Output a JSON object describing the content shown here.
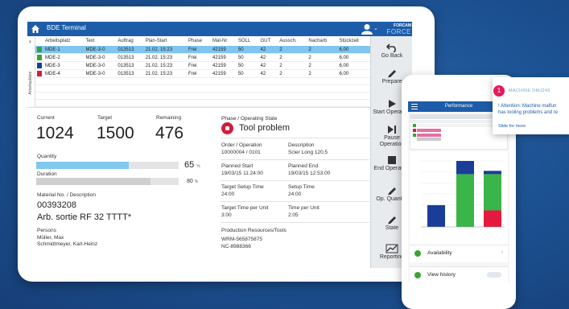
{
  "app": {
    "title": "BDE Terminal",
    "brand_top": "FORCAM",
    "brand_bottom": "FORCE"
  },
  "grid": {
    "columns": [
      "Arbeitsplatz",
      "Text",
      "Auftrag",
      "Plan-Start",
      "Phase",
      "Mat-Nr",
      "SOLL",
      "GUT",
      "Aussch.",
      "Nacharb",
      "Stückzeit"
    ],
    "side_label": "Arbeitsplätze",
    "rows": [
      {
        "status_color": "#3aa335",
        "cells": [
          "MDE-1",
          "MDE-3-0",
          "013513",
          "21.02. 15:23",
          "Frei",
          "42159",
          "50",
          "42",
          "2",
          "2",
          "6,00"
        ]
      },
      {
        "status_color": "#3aa335",
        "cells": [
          "MDE-2",
          "MDE-3-0",
          "013513",
          "21.02. 15:23",
          "Frei",
          "42159",
          "50",
          "42",
          "2",
          "2",
          "6,00"
        ]
      },
      {
        "status_color": "#1a3e97",
        "cells": [
          "MDE-3",
          "MDE-3-0",
          "013513",
          "21.02. 15:23",
          "Frei",
          "42159",
          "50",
          "42",
          "2",
          "2",
          "6,00"
        ]
      },
      {
        "status_color": "#d31c3c",
        "cells": [
          "MDE-4",
          "MDE-3-0",
          "013513",
          "21.02. 15:23",
          "Frei",
          "42159",
          "50",
          "42",
          "2",
          "2",
          "6,00"
        ]
      }
    ]
  },
  "commands": [
    {
      "label": "Go Back",
      "icon": "undo-icon"
    },
    {
      "label": "Prepare",
      "icon": "pencil-icon"
    },
    {
      "label": "Start Operation",
      "icon": "play-icon"
    },
    {
      "label": "Pause Operation",
      "icon": "pause-icon"
    },
    {
      "label": "End Operation",
      "icon": "stop-icon"
    },
    {
      "label": "Op. Quantity",
      "icon": "pencil-icon"
    },
    {
      "label": "State",
      "icon": "pencil-icon"
    },
    {
      "label": "Reporting",
      "icon": "chart-icon"
    }
  ],
  "kpi": {
    "current_label": "Current",
    "current_value": "1024",
    "target_label": "Target",
    "target_value": "1500",
    "remaining_label": "Remaining",
    "remaining_value": "476"
  },
  "progress": {
    "quantity_label": "Quantity",
    "quantity_value": "65",
    "quantity_fraction": 0.65,
    "quantity_color": "#82c8ee",
    "duration_label": "Duration",
    "duration_value": "80",
    "duration_fraction": 0.8,
    "duration_color": "#cfcfcf",
    "unit": "%"
  },
  "material": {
    "label": "Material No. / Description",
    "number": "00393208",
    "description": "Arb. sortie RF 32 TTTT*"
  },
  "persons": {
    "label": "Persons",
    "names": [
      "Müller, Max",
      "Schmidtmeyer, Karl-Heinz"
    ]
  },
  "phase": {
    "label": "Phase / Operating State",
    "state": "Tool problem",
    "state_color": "#d31c3c"
  },
  "details": {
    "order_label": "Order / Operation",
    "order_value": "10000004 / 0101",
    "desc_label": "Description",
    "desc_value": "Scier Long 120,5",
    "pstart_label": "Planned Start",
    "pstart_value": "19/03/15 11:24:00",
    "pend_label": "Planned End",
    "pend_value": "19/03/15 12:53:00",
    "tsetup_label": "Target Setup Time",
    "tsetup_value": "24:00",
    "setup_label": "Setup Time",
    "setup_value": "24:00",
    "tpu_label": "Target Time per Unit",
    "tpu_value": "3:00",
    "time_pu_label": "Time per Unit",
    "time_pu_value": "2:05",
    "res_label": "Production Resources/Tools",
    "res_values": [
      "WRM-565875875",
      "NC-8988366"
    ]
  },
  "mobile": {
    "title": "Performance",
    "availability_label": "Availability",
    "history_label": "View history",
    "chart_bars": [
      {
        "blue": 0.33,
        "green": 0,
        "red": 0
      },
      {
        "blue": 0.2,
        "green": 0.8,
        "red": 0
      },
      {
        "blue": 0.05,
        "green": 0.55,
        "red": 0.25
      }
    ]
  },
  "notification": {
    "count": "1",
    "machine": "MACHINE DMJ249",
    "message_lines": [
      "! Attention: Machine malfun",
      "has tooling problems and re"
    ],
    "more": "Slide for more"
  }
}
